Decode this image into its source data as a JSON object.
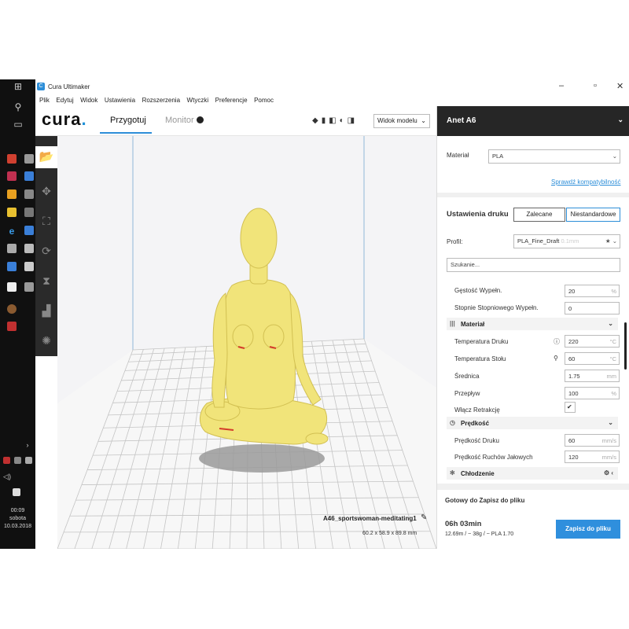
{
  "window": {
    "title": "Cura Ultimaker",
    "minimize": "–",
    "maximize": "▫",
    "close": "✕"
  },
  "menu": [
    "Plik",
    "Edytuj",
    "Widok",
    "Ustawienia",
    "Rozszerzenia",
    "Wtyczki",
    "Preferencje",
    "Pomoc"
  ],
  "header": {
    "logo": "cura",
    "logo_dot": ".",
    "tab_prepare": "Przygotuj",
    "tab_monitor": "Monitor",
    "view_select": "Widok modelu"
  },
  "viewport": {
    "model_name": "A46_sportswoman-meditating1",
    "model_size": "60.2 x 58.9 x 89.8 mm"
  },
  "panel": {
    "printer": "Anet A6",
    "material_label": "Materiał",
    "material_value": "PLA",
    "compat_link": "Sprawdź kompatybilność",
    "print_settings": "Ustawienia druku",
    "recommended": "Zalecane",
    "custom": "Niestandardowe",
    "profile_label": "Profil:",
    "profile_value": "PLA_Fine_Draft",
    "profile_suffix": "0.1mm",
    "search_placeholder": "Szukanie...",
    "settings": {
      "infill_density_label": "Gęstość Wypełn.",
      "infill_density_value": "20",
      "infill_density_unit": "%",
      "gradual_infill_label": "Stopnie Stopniowego Wypełn.",
      "gradual_infill_value": "0",
      "cat_material": "Materiał",
      "print_temp_label": "Temperatura Druku",
      "print_temp_value": "220",
      "print_temp_unit": "°C",
      "bed_temp_label": "Temperatura Stołu",
      "bed_temp_value": "60",
      "bed_temp_unit": "°C",
      "diameter_label": "Średnica",
      "diameter_value": "1.75",
      "diameter_unit": "mm",
      "flow_label": "Przepływ",
      "flow_value": "100",
      "flow_unit": "%",
      "retraction_label": "Włącz Retrakcję",
      "retraction_check": "✔",
      "cat_speed": "Prędkość",
      "print_speed_label": "Prędkość Druku",
      "print_speed_value": "60",
      "print_speed_unit": "mm/s",
      "travel_speed_label": "Prędkość Ruchów Jałowych",
      "travel_speed_value": "120",
      "travel_speed_unit": "mm/s",
      "cat_cooling": "Chłodzenie"
    },
    "ready_label": "Gotowy do Zapisz do pliku",
    "print_time": "06h 03min",
    "print_stats": "12.69m / ~ 38g / ~ PLA 1.70",
    "save_button": "Zapisz do pliku"
  },
  "taskbar": {
    "clock_time": "00:09",
    "clock_day": "sobota",
    "clock_date": "10.03.2018"
  },
  "colors": {
    "accent": "#2d8ed8",
    "model": "#f1e47a",
    "dark_bar": "#262626"
  }
}
